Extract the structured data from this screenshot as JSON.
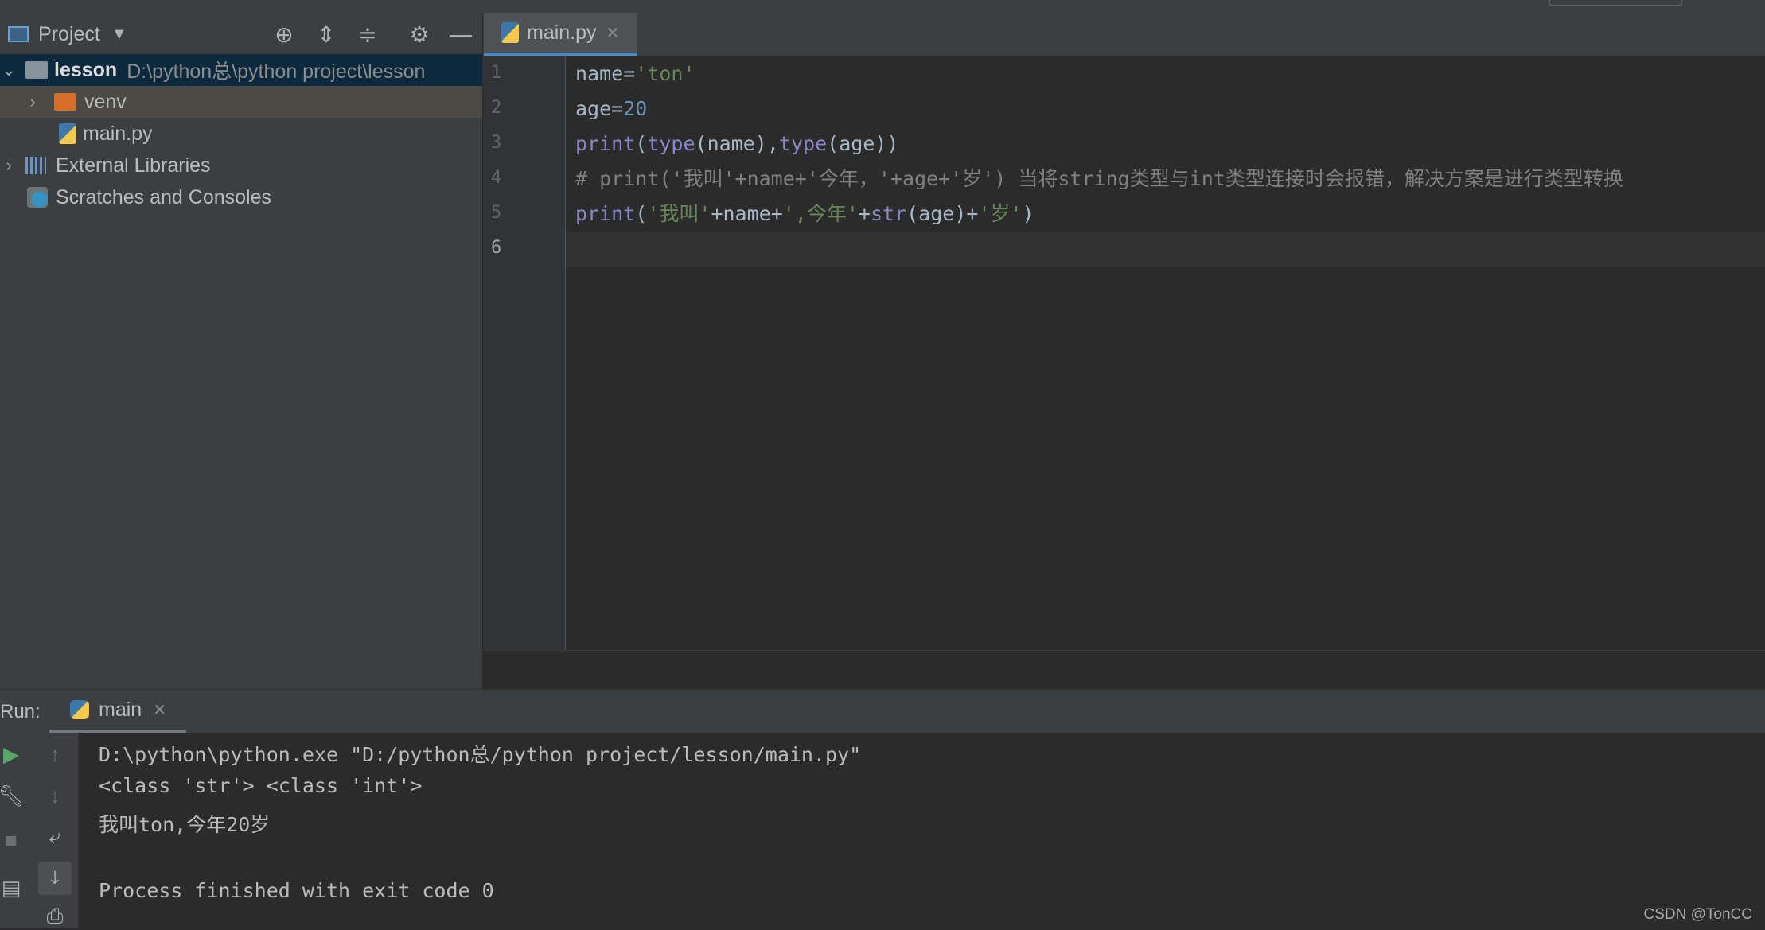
{
  "project_panel": {
    "title": "Project",
    "tree": [
      {
        "name": "lesson",
        "path": "D:\\python总\\python project\\lesson"
      },
      {
        "name": "venv"
      },
      {
        "name": "main.py"
      },
      {
        "name": "External Libraries"
      },
      {
        "name": "Scratches and Consoles"
      }
    ]
  },
  "editor": {
    "tab_label": "main.py",
    "line_numbers": [
      "1",
      "2",
      "3",
      "4",
      "5",
      "6"
    ],
    "lines": [
      [
        {
          "t": "name=",
          "c": "plain"
        },
        {
          "t": "'ton'",
          "c": "str"
        }
      ],
      [
        {
          "t": "age=",
          "c": "plain"
        },
        {
          "t": "20",
          "c": "num"
        }
      ],
      [
        {
          "t": "print",
          "c": "kw"
        },
        {
          "t": "(",
          "c": "plain"
        },
        {
          "t": "type",
          "c": "kw"
        },
        {
          "t": "(name)",
          "c": "plain"
        },
        {
          "t": ",",
          "c": "plain"
        },
        {
          "t": "type",
          "c": "kw"
        },
        {
          "t": "(age))",
          "c": "plain"
        }
      ],
      [
        {
          "t": "# print('我叫'+name+'今年，'+age+'岁') 当将string类型与int类型连接时会报错，解决方案是进行类型转换",
          "c": "cmt"
        }
      ],
      [
        {
          "t": "print",
          "c": "kw"
        },
        {
          "t": "(",
          "c": "plain"
        },
        {
          "t": "'我叫'",
          "c": "str"
        },
        {
          "t": "+name+",
          "c": "plain"
        },
        {
          "t": "',今年'",
          "c": "str"
        },
        {
          "t": "+",
          "c": "plain"
        },
        {
          "t": "str",
          "c": "kw"
        },
        {
          "t": "(age)+",
          "c": "plain"
        },
        {
          "t": "'岁'",
          "c": "str"
        },
        {
          "t": ")",
          "c": "plain"
        }
      ],
      []
    ]
  },
  "run": {
    "label": "Run:",
    "tab_label": "main",
    "console_lines": [
      "D:\\python\\python.exe \"D:/python总/python project/lesson/main.py\"",
      "<class 'str'> <class 'int'>",
      "我叫ton,今年20岁",
      "",
      "Process finished with exit code 0"
    ]
  },
  "watermark": "CSDN @TonCC"
}
